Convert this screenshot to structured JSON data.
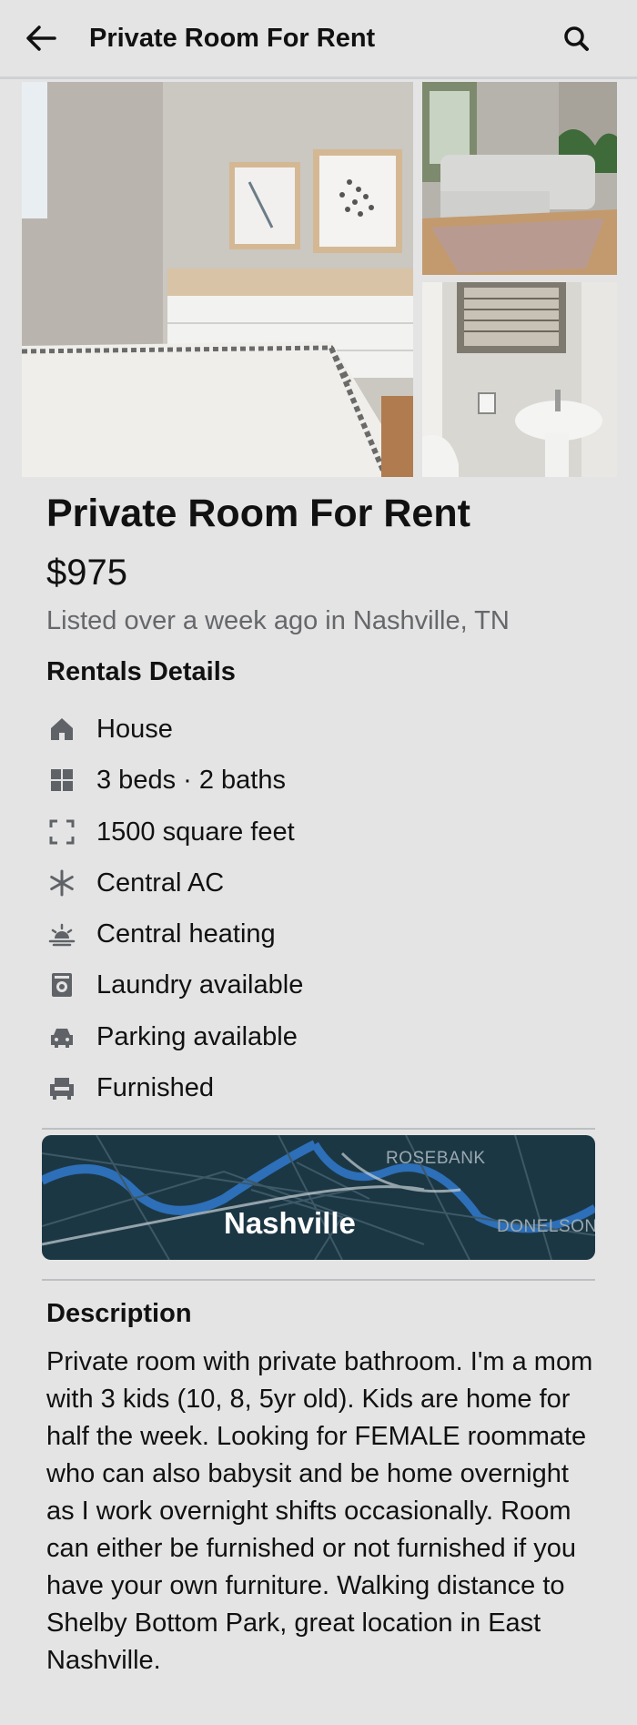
{
  "topbar": {
    "title": "Private Room For Rent"
  },
  "listing": {
    "title": "Private Room For Rent",
    "price": "$975",
    "meta": "Listed over a week ago in Nashville, TN"
  },
  "details": {
    "heading": "Rentals Details",
    "items": [
      {
        "icon": "house-icon",
        "label": "House"
      },
      {
        "icon": "rooms-icon",
        "label": "3 beds · 2 baths"
      },
      {
        "icon": "square-feet-icon",
        "label": "1500 square feet"
      },
      {
        "icon": "snowflake-icon",
        "label": "Central AC"
      },
      {
        "icon": "sun-heating-icon",
        "label": "Central heating"
      },
      {
        "icon": "laundry-icon",
        "label": "Laundry available"
      },
      {
        "icon": "car-icon",
        "label": "Parking available"
      },
      {
        "icon": "armchair-icon",
        "label": "Furnished"
      }
    ]
  },
  "map": {
    "city": "Nashville",
    "labels": [
      "ROSEBANK",
      "DONELSON"
    ]
  },
  "description": {
    "heading": "Description",
    "text": "Private room with private bathroom. I'm a mom with 3 kids (10, 8, 5yr old). Kids are home for half the week. Looking for FEMALE roommate who can also babysit and be home overnight as I work overnight shifts occasionally. Room can either be furnished or not furnished if you have your own furniture. Walking distance to Shelby Bottom Park, great location in East Nashville."
  },
  "colors": {
    "background": "#e4e4e4",
    "text_primary": "#111111",
    "text_secondary": "#65676b",
    "map_background": "#1c3744"
  }
}
